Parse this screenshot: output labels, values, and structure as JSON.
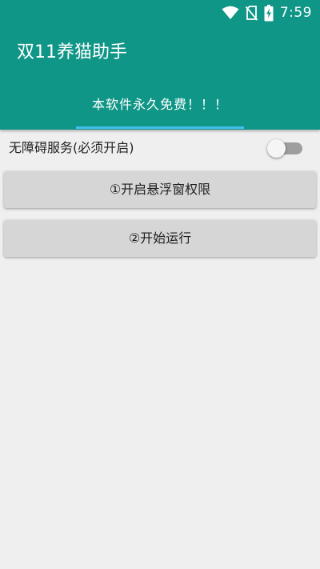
{
  "status_bar": {
    "time": "7:59",
    "icons": [
      "wifi-icon",
      "no-sim-icon",
      "battery-charging-icon"
    ]
  },
  "app_bar": {
    "title": "双11养猫助手",
    "background_color": "#0f9687"
  },
  "tabs": [
    {
      "label": "本软件永久免费！！！",
      "selected": true,
      "indicator_color": "#3fc0e8"
    }
  ],
  "accessibility": {
    "label": "无障碍服务(必须开启)",
    "enabled": false
  },
  "buttons": {
    "overlay_permission": "①开启悬浮窗权限",
    "start": "②开始运行"
  }
}
